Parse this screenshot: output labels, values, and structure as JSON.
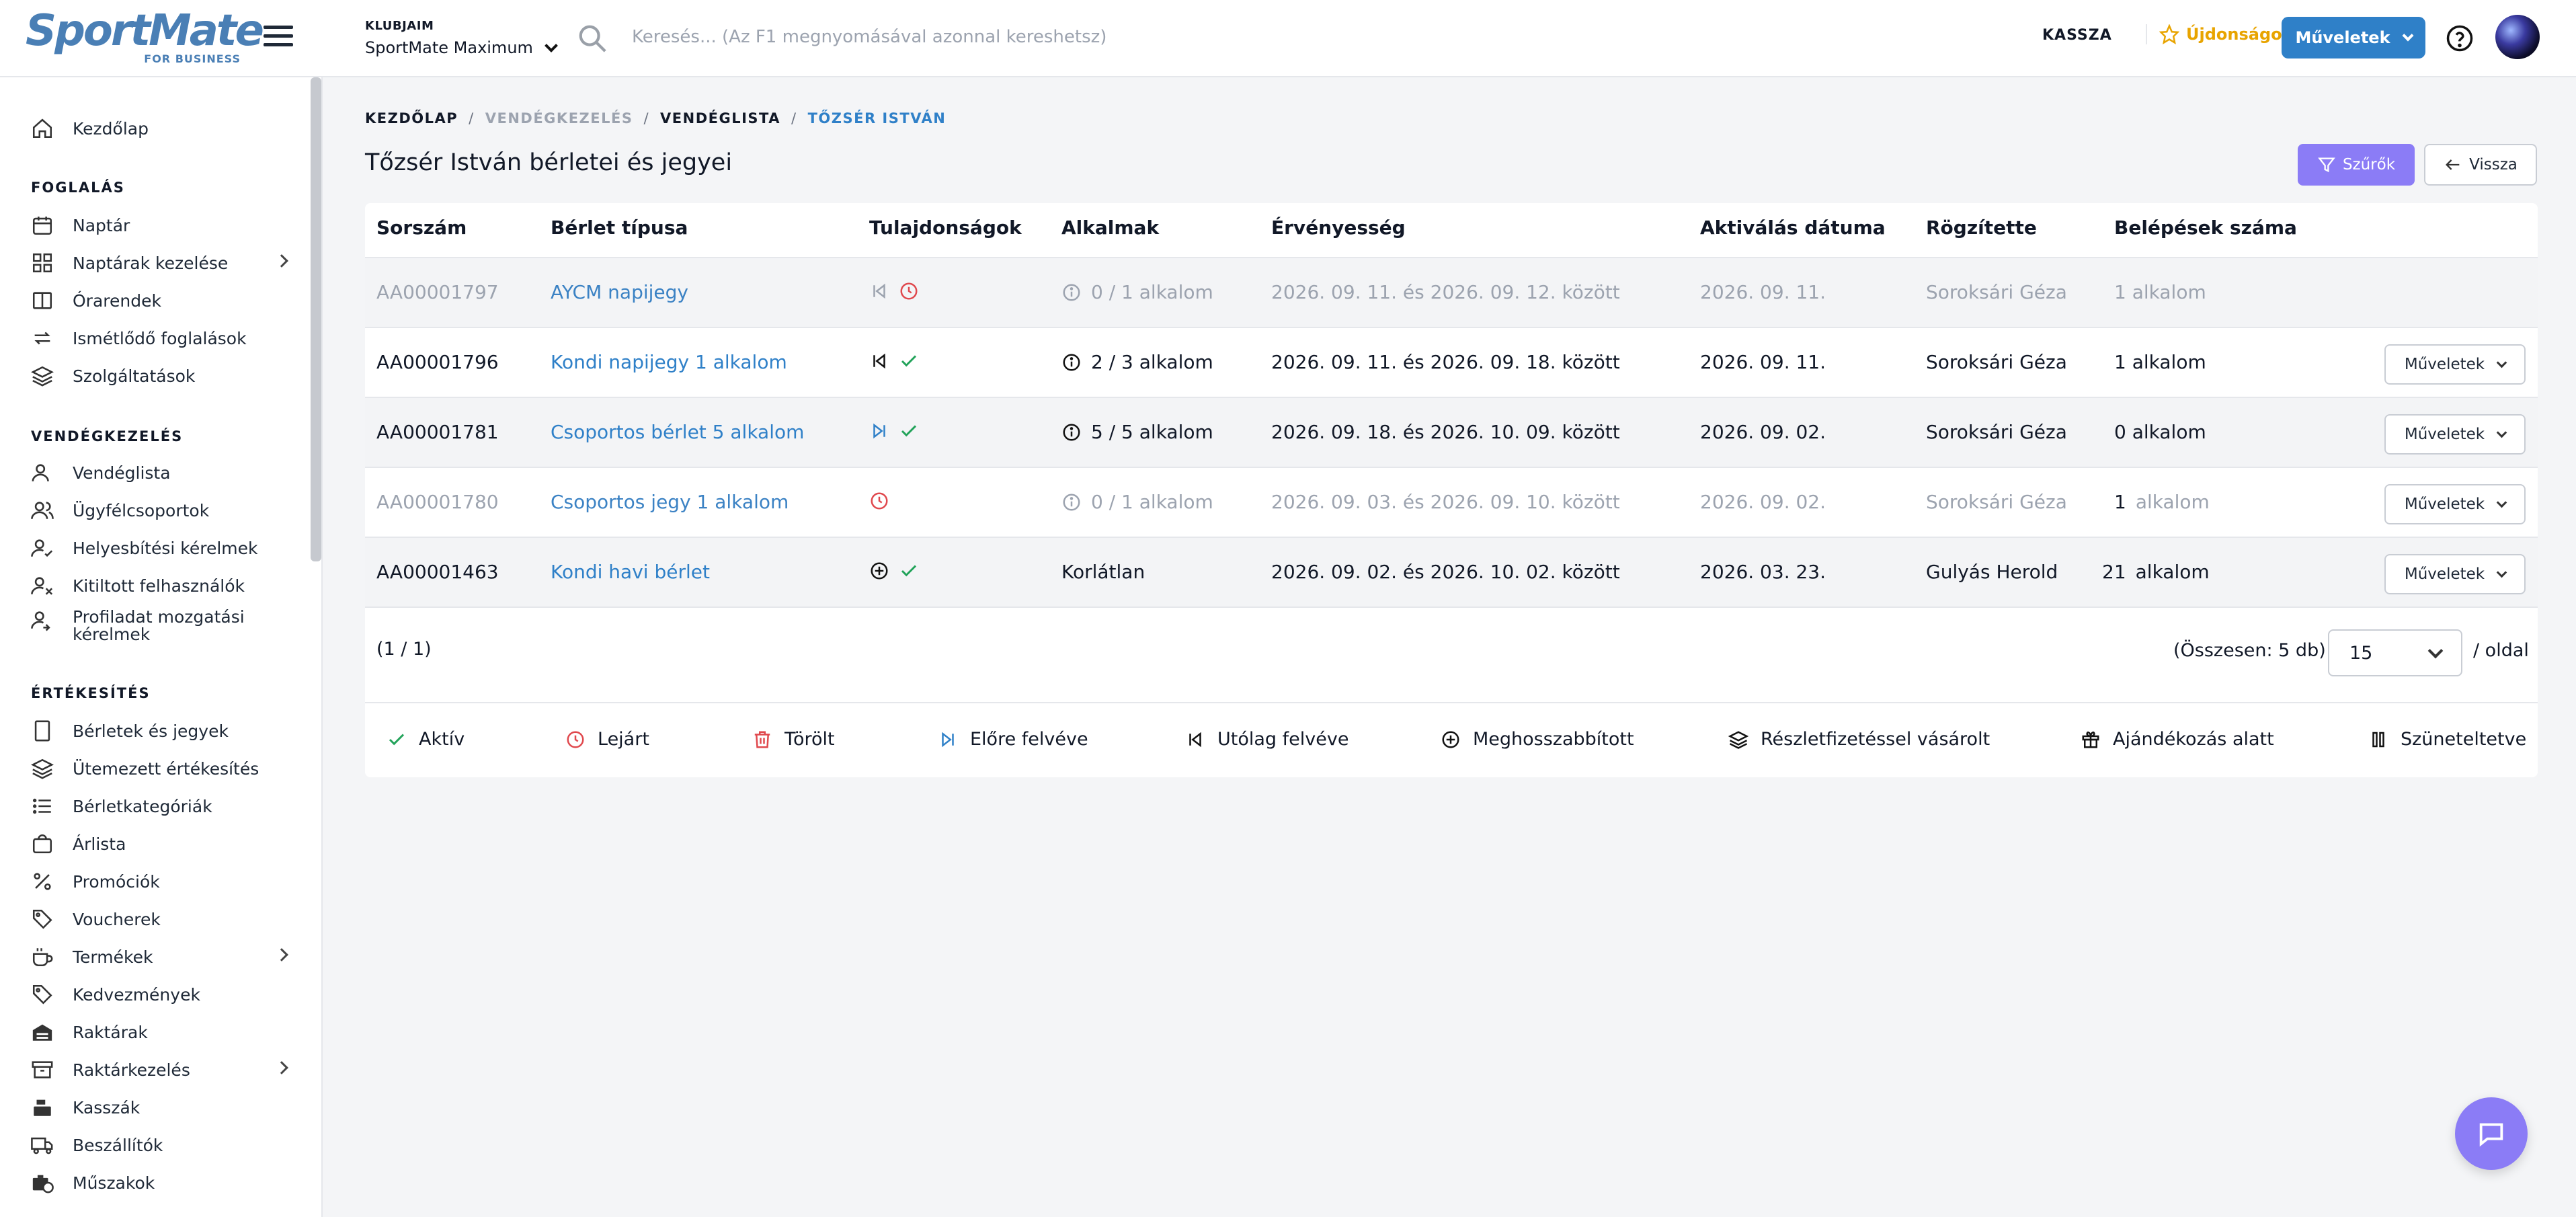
{
  "header": {
    "logo_main": "SportMate",
    "logo_sub": "FOR BUSINESS",
    "club_label": "KLUBJAIM",
    "club_name": "SportMate Maximum",
    "search_placeholder": "Keresés... (Az F1 megnyomásával azonnal kereshetsz)",
    "kassza": "KASSZA",
    "news": "Újdonságok",
    "actions": "Műveletek",
    "accent": "#2f80c8"
  },
  "sidebar": {
    "home": "Kezdőlap",
    "sections": {
      "booking": "FOGLALÁS",
      "guests": "VENDÉGKEZELÉS",
      "sales": "ÉRTÉKESÍTÉS"
    },
    "booking_items": [
      "Naptár",
      "Naptárak kezelése",
      "Órarendek",
      "Ismétlődő foglalások",
      "Szolgáltatások"
    ],
    "guest_items": [
      "Vendéglista",
      "Ügyfélcsoportok",
      "Helyesbítési kérelmek",
      "Kitiltott felhasználók",
      "Profiladat mozgatási",
      "kérelmek"
    ],
    "sales_items": [
      "Bérletek és jegyek",
      "Ütemezett értékesítés",
      "Bérletkategóriák",
      "Árlista",
      "Promóciók",
      "Voucherek",
      "Termékek",
      "Kedvezmények",
      "Raktárak",
      "Raktárkezelés",
      "Kasszák",
      "Beszállítók",
      "Műszakok"
    ]
  },
  "breadcrumb": [
    "KEZDŐLAP",
    "VENDÉGKEZELÉS",
    "VENDÉGLISTA",
    "TŐZSÉR ISTVÁN"
  ],
  "page": {
    "title": "Tőzsér István bérletei és jegyei",
    "filter_button": "Szűrők",
    "back_button": "Vissza"
  },
  "table": {
    "headers": [
      "Sorszám",
      "Bérlet típusa",
      "Tulajdonságok",
      "Alkalmak",
      "Érvényesség",
      "Aktiválás dátuma",
      "Rögzítette",
      "Belépések száma"
    ],
    "row_action": "Műveletek",
    "rows": [
      {
        "id": "AA00001797",
        "type": "AYCM napijegy",
        "occasions": "0 / 1 alkalom",
        "validity": "2026. 09. 11. és 2026. 09. 12. között",
        "activation": "2026. 09. 11.",
        "recorded_by": "Soroksári Géza",
        "entries": "1 alkalom"
      },
      {
        "id": "AA00001796",
        "type": "Kondi napijegy 1 alkalom",
        "occasions": "2 / 3 alkalom",
        "validity": "2026. 09. 11. és 2026. 09. 18. között",
        "activation": "2026. 09. 11.",
        "recorded_by": "Soroksári Géza",
        "entries": "1 alkalom"
      },
      {
        "id": "AA00001781",
        "type": "Csoportos bérlet 5 alkalom",
        "occasions": "5 / 5 alkalom",
        "validity": "2026. 09. 18. és 2026. 10. 09. között",
        "activation": "2026. 09. 02.",
        "recorded_by": "Soroksári Géza",
        "entries": "0 alkalom"
      },
      {
        "id": "AA00001780",
        "type": "Csoportos jegy 1 alkalom",
        "occasions": "0 / 1 alkalom",
        "validity": "2026. 09. 03. és 2026. 09. 10. között",
        "activation": "2026. 09. 02.",
        "recorded_by": "Soroksári Géza",
        "entries_num": "1",
        "entries_unit": "alkalom"
      },
      {
        "id": "AA00001463",
        "type": "Kondi havi bérlet",
        "occasions": "Korlátlan",
        "validity": "2026. 09. 02. és 2026. 10. 02. között",
        "activation": "2026. 03. 23.",
        "recorded_by": "Gulyás Herold",
        "entries_num": "21",
        "entries_unit": "alkalom"
      }
    ]
  },
  "pagination": {
    "info": "(1 / 1)",
    "total": "(Összesen: 5 db)",
    "per_page": "15",
    "per_page_label": "/ oldal"
  },
  "legend": [
    "Aktív",
    "Lejárt",
    "Törölt",
    "Előre felvéve",
    "Utólag felvéve",
    "Meghosszabbított",
    "Részletfizetéssel vásárolt",
    "Ajándékozás alatt",
    "Szüneteltetve"
  ],
  "colors": {
    "active_green": "#22a35a",
    "expired_red": "#e0484d",
    "link_blue": "#2f80c8",
    "filter_purple": "#8b7cf6"
  }
}
